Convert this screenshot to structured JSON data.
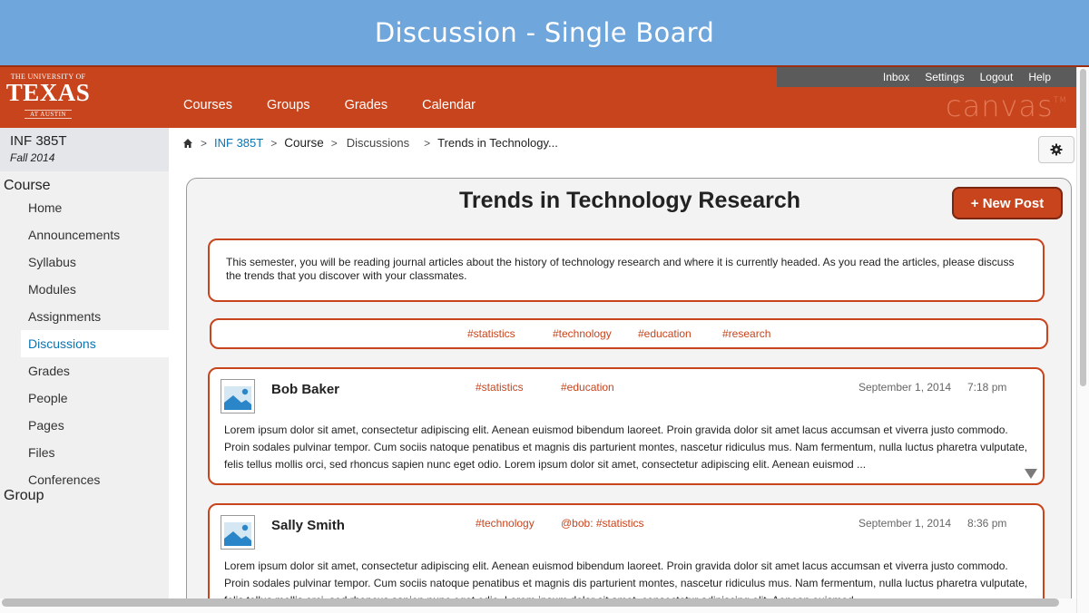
{
  "slide": {
    "title": "Discussion - Single Board"
  },
  "logo": {
    "line1": "THE UNIVERSITY OF",
    "line2": "TEXAS",
    "line3": "AT AUSTIN"
  },
  "utility_nav": [
    "Inbox",
    "Settings",
    "Logout",
    "Help"
  ],
  "main_nav": [
    "Courses",
    "Groups",
    "Grades",
    "Calendar"
  ],
  "brand": {
    "name": "canvas",
    "tm": "TM"
  },
  "course": {
    "name": "INF 385T",
    "term": "Fall 2014"
  },
  "sidebar": {
    "course_section": "Course",
    "items": [
      "Home",
      "Announcements",
      "Syllabus",
      "Modules",
      "Assignments",
      "Discussions",
      "Grades",
      "People",
      "Pages",
      "Files",
      "Conferences"
    ],
    "active": "Discussions",
    "group_section": "Group"
  },
  "breadcrumb": {
    "sep": ">",
    "items": [
      "INF 385T",
      "Course",
      "Discussions",
      "Trends in Technology..."
    ],
    "last_prefix": ">"
  },
  "board": {
    "title": "Trends in Technology Research",
    "new_post_label": "+ New Post",
    "description": "This semester, you will be reading journal articles about the history of technology research and where it is currently headed.  As you read the articles, please discuss the trends that you discover with your classmates.",
    "tags": [
      "#statistics",
      "#technology",
      "#education",
      "#research"
    ]
  },
  "posts": [
    {
      "author": "Bob Baker",
      "tags": [
        "#statistics",
        "#education"
      ],
      "date": "September 1, 2014",
      "time": "7:18 pm",
      "body": "Lorem ipsum dolor sit amet, consectetur adipiscing elit. Aenean euismod bibendum laoreet. Proin gravida dolor sit amet lacus accumsan et viverra justo commodo. Proin sodales pulvinar tempor. Cum sociis natoque penatibus et magnis dis parturient montes, nascetur ridiculus mus. Nam fermentum, nulla luctus pharetra vulputate, felis tellus mollis orci, sed rhoncus sapien nunc eget odio.  Lorem ipsum dolor sit amet, consectetur adipiscing elit. Aenean euismod ..."
    },
    {
      "author": "Sally Smith",
      "tags": [
        "#technology",
        "@bob: #statistics"
      ],
      "date": "September 1, 2014",
      "time": "8:36 pm",
      "body": "Lorem ipsum dolor sit amet, consectetur adipiscing elit. Aenean euismod bibendum laoreet. Proin gravida dolor sit amet lacus accumsan et viverra justo commodo. Proin sodales pulvinar tempor. Cum sociis natoque penatibus et magnis dis parturient montes, nascetur ridiculus mus. Nam fermentum, nulla luctus pharetra vulputate, felis tellus mollis orci, sed rhoncus sapien nunc eget odio.  Lorem ipsum dolor sit amet, consectetur adipiscing elit. Aenean euismod ..."
    }
  ],
  "colors": {
    "accent": "#c7441d",
    "banner": "#6fa6dc",
    "link": "#0b74b3"
  }
}
